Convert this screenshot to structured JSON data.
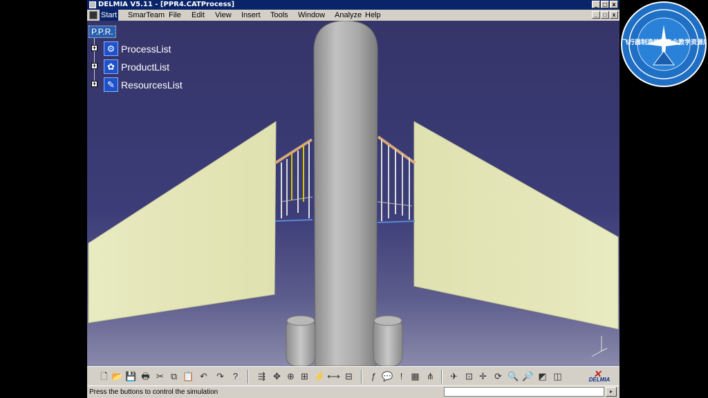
{
  "window": {
    "title": "DELMIA V5.11 - [PPR4.CATProcess]",
    "controls": [
      "_",
      "□",
      "x"
    ],
    "doc_controls": [
      "_",
      "□",
      "x"
    ]
  },
  "menubar": {
    "items": [
      "Start",
      "SmarTeam",
      "File",
      "Edit",
      "View",
      "Insert",
      "Tools",
      "Window",
      "Analyze",
      "Help"
    ]
  },
  "tree": {
    "root_label": "P.P.R.",
    "nodes": [
      {
        "label": "ProcessList",
        "icon": "process-list-icon"
      },
      {
        "label": "ProductList",
        "icon": "product-list-icon"
      },
      {
        "label": "ResourcesList",
        "icon": "resources-list-icon"
      }
    ]
  },
  "toolbar": {
    "brand_logo_text": "DELMIA",
    "icons": [
      "new-icon",
      "open-icon",
      "save-icon",
      "print-icon",
      "cut-icon",
      "copy-icon",
      "paste-icon",
      "undo-icon",
      "redo-icon",
      "whats-this-icon",
      "simulation-icon",
      "manipulate-icon",
      "compass-icon",
      "snap-icon",
      "clash-icon",
      "measure-icon",
      "section-icon",
      "formula-icon",
      "comment-icon",
      "knowledge-icon",
      "catalog-icon",
      "tree-expand-icon",
      "fly-mode-icon",
      "fit-all-icon",
      "pan-icon",
      "rotate-icon",
      "zoom-in-icon",
      "zoom-out-icon",
      "normal-view-icon",
      "view-mode-icon"
    ]
  },
  "status": {
    "message": "Press the buttons to control the simulation"
  },
  "watermark": {
    "text": "飞行器制造技术专业教学资源库"
  },
  "colors": {
    "title_bar": "#0a246a",
    "viewport_top": "#35356a",
    "viewport_bottom": "#8a8aac",
    "wing": "#e6e8b8",
    "fuselage": "#a9a9a9",
    "tree_icon": "#1e52c8",
    "badge": "#1f6fc4"
  }
}
